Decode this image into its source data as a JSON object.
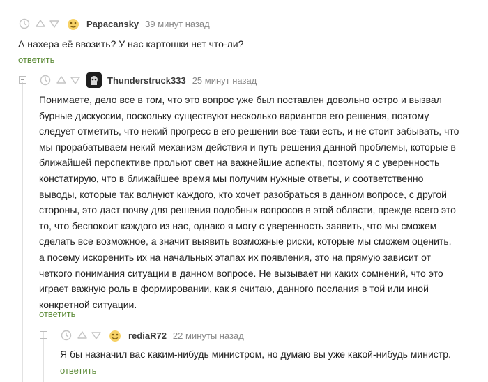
{
  "comments": [
    {
      "author": "Papacansky",
      "time": "39 минут назад",
      "lines": [
        "А нахера её ввозить? У нас картошки нет что-ли?"
      ],
      "reply_label": "ответить"
    },
    {
      "author": "Thunderstruck333",
      "time": "25 минут назад",
      "lines": [
        "Понимаете, дело все в том, что это вопрос уже был поставлен довольно остро и вызвал",
        "бурные дискуссии, поскольку существуют несколько вариантов его решения, поэтому",
        "следует отметить, что некий прогресс в его решении все-таки есть, и не стоит забывать, что",
        "мы прорабатываем некий механизм действия и путь решения данной проблемы, которые в",
        "ближайшей перспективе прольют свет на важнейшие аспекты, поэтому я с уверенность",
        "констатирую, что в ближайшее время мы получим нужные ответы, и соответственно",
        "выводы, которые так волнуют каждого, кто хочет разобраться в данном вопросе, с другой",
        "стороны, это даст почву для решения подобных вопросов в этой области, прежде всего это",
        "то, что беспокоит каждого из нас, однако я могу с уверенность заявить, что мы сможем",
        "сделать все возможное, а значит выявить возможные риски, которые мы сможем оценить,",
        "а посему искоренить их на начальных этапах их появления, это на прямую зависит от",
        "четкого понимания ситуации в данном вопросе. Не вызывает ни каких сомнений, что это",
        "играет важную роль в формировании, как я считаю, данного послания в той или иной",
        "конкретной ситуации."
      ],
      "reply_label": "ответить"
    },
    {
      "author": "rediaR72",
      "time": "22 минуты назад",
      "lines": [
        "Я бы назначил вас каким-нибудь министром, но думаю вы уже какой-нибудь министр."
      ],
      "reply_label": "ответить"
    }
  ],
  "icons": {
    "clock": "clock-icon",
    "upvote": "upvote-icon",
    "downvote": "downvote-icon",
    "collapse": "collapse-icon"
  },
  "colors": {
    "reply_link": "#5b8a36",
    "author": "#3a3a3a",
    "time": "#888888",
    "text": "#222222",
    "icons": "#c4c4c4"
  }
}
